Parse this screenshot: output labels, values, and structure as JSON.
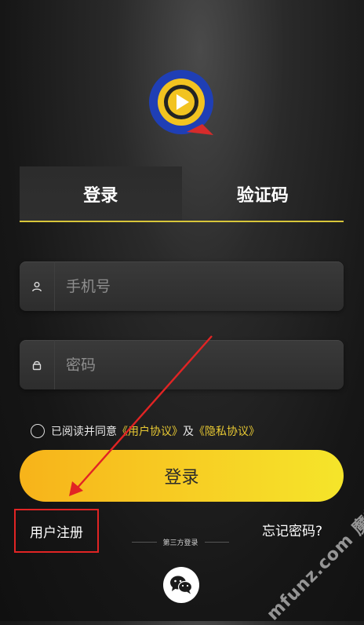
{
  "tabs": [
    {
      "label": "登录",
      "active": true
    },
    {
      "label": "验证码",
      "active": false
    }
  ],
  "form": {
    "phone_placeholder": "手机号",
    "password_placeholder": "密码",
    "phone_icon": "user-icon",
    "password_icon": "lock-icon"
  },
  "agreement": {
    "prefix": "已阅读并同意",
    "user_agreement": "《用户协议》",
    "and": "及",
    "privacy_agreement": "《隐私协议》"
  },
  "login_button": "登录",
  "register_link": "用户注册",
  "forgot_link": "忘记密码?",
  "third_party_label": "第三方登录",
  "watermark": "mfunz.com 魔趣网",
  "colors": {
    "accent_yellow": "#e8c933",
    "annotation_red": "#e12424"
  }
}
